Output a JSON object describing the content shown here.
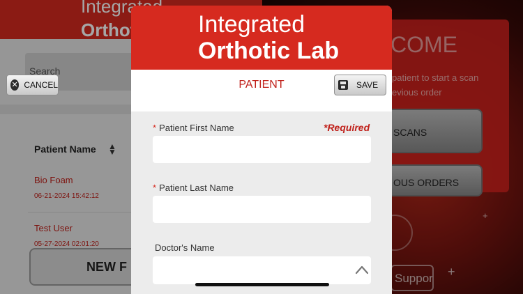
{
  "background": {
    "header": {
      "logo_line1": "Integrated",
      "logo_line2": "Orthotic Lab"
    },
    "search": {
      "placeholder": "Search"
    },
    "list": {
      "column_header": "Patient Name",
      "rows": [
        {
          "name": "Bio Foam",
          "date": "06-21-2024 15:42:12"
        },
        {
          "name": "Test User",
          "date": "05-27-2024 02:01:20"
        }
      ]
    },
    "new_button_label": "NEW F",
    "welcome": {
      "title": "COME",
      "line1": "patient to start a scan",
      "line2": "evious order",
      "scans_button": "SCANS",
      "orders_button": "OUS ORDERS",
      "support_label": "Support"
    }
  },
  "modal": {
    "logo_line1": "Integrated",
    "logo_line2": "Orthotic Lab",
    "toolbar": {
      "cancel_label": "CANCEL",
      "title": "PATIENT",
      "save_label": "SAVE"
    },
    "form": {
      "required_note": "*Required",
      "first_name": {
        "label": "Patient First Name",
        "required_mark": "*",
        "value": ""
      },
      "last_name": {
        "label": "Patient Last Name",
        "required_mark": "*",
        "value": ""
      },
      "doctor_name": {
        "label": "Doctor's Name",
        "value": ""
      }
    }
  },
  "colors": {
    "brand_red": "#d62a1f",
    "text_red": "#c0201a"
  },
  "icons": {
    "cancel": "close-circle-icon",
    "save": "floppy-disk-icon",
    "sort": "sort-arrows-icon",
    "collapse": "chevron-up-icon"
  }
}
